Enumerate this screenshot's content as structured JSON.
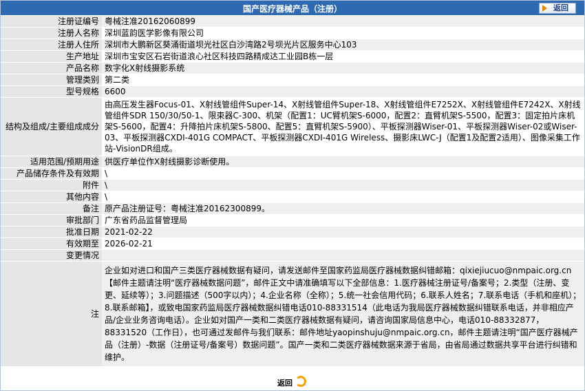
{
  "header": {
    "title": "国产医疗器械产品（注册）",
    "back_label": "返回"
  },
  "rows": [
    {
      "label": "注册证编号",
      "value": "粤械注准20162060899"
    },
    {
      "label": "注册人名称",
      "value": "深圳蓝韵医学影像有限公司"
    },
    {
      "label": "注册人住所",
      "value": "深圳市大鹏新区葵涌街道坝光社区白沙湾路2号坝光片区服务中心103"
    },
    {
      "label": "生产地址",
      "value": "深圳市宝安区石岩街道浪心社区科技四路精成达工业园B栋一层"
    },
    {
      "label": "产品名称",
      "value": "数字化X射线摄影系统"
    },
    {
      "label": "管理类别",
      "value": "第二类"
    },
    {
      "label": "型号规格",
      "value": "6600"
    },
    {
      "label": "结构及组成/主要组成成分",
      "value": "由高压发生器Focus-01、X射线管组件Super-14、X射线管组件Super-18、X射线管组件E7252X、X射线管组件E7242X、X射线管组件SDR 150/30/50-1、限束器C-300、机架（配置1：UC臂机架S-6000，配置2：直臂机架S-5500，配置3：固定拍片床机架S-5600，配置4：升降拍片床机架S-5800、配置5：直臂机架S-5900）、平板探测器Wiser-01、平板探测器Wiser-02或Wiser-03、平板探测器CXDI-401G COMPACT、平板探测器CXDI-401G Wireless、摄影床LWC-J（配置1及配置2适用）、图像采集工作站-VisionDR组成。"
    },
    {
      "label": "适用范围/预期用途",
      "value": "供医疗单位作X射线摄影诊断使用。"
    },
    {
      "label": "产品储存条件及有效期",
      "value": "\\"
    },
    {
      "label": "附件",
      "value": "\\"
    },
    {
      "label": "其他内容",
      "value": "\\"
    },
    {
      "label": "备注",
      "value": "原产品注册证号：粤械注准20162300899。"
    },
    {
      "label": "审批部门",
      "value": "广东省药品监督管理局"
    },
    {
      "label": "批准日期",
      "value": "2021-02-22"
    },
    {
      "label": "有效期至",
      "value": "2026-02-21"
    },
    {
      "label": "变更情况",
      "value": ""
    }
  ],
  "note": {
    "label": "注",
    "text": "企业如对进口和国产三类医疗器械数据有疑问，请发送邮件至国家药监局医疗器械数据纠错邮箱：qixiejiucuo@nmpaic.org.cn【邮件主题请注明“医疗器械数据问题”，邮件正文中请准确填写以下全部信息：1.医疗器械注册证号/备案号；2.类型（注册、变更、延续等）；3.问题描述（500字以内）；4.企业名称（全称）；5.统一社会信用代码；6.联系人姓名；7.联系电话（手机和座机）；8.联系邮箱】，或致电国家药监局医疗器械数据纠错电话010-88331514（此电话为我局医疗器械数据纠错联系电话，并非相应产品/企业业务咨询电话）。企业如对国产一类和二类医疗器械数据有疑问，请咨询国家局信息中心，电话010-88332877，88331520（工作日），也可通过发邮件与我们联系：邮件地址yaopinshuju@nmpaic.org.cn，邮件主题请注明“国产医疗器械产品（注册）-数据（注册证号/备案号）数据问题”。国产一类和二类医疗器械数据来源于省局，由省局通过数据共享平台进行纠错和维护。"
  },
  "footer": {
    "back_label": "返回"
  }
}
